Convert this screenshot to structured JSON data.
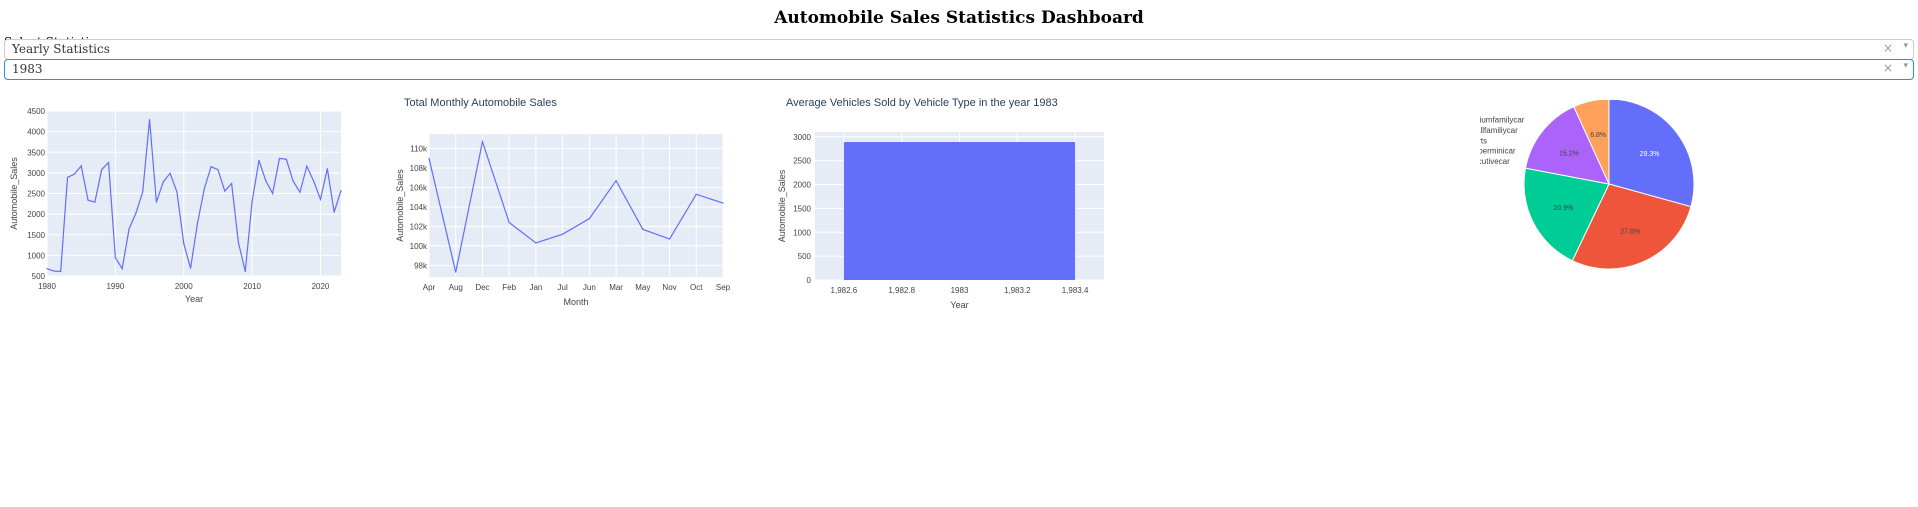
{
  "page": {
    "title": "Automobile Sales Statistics Dashboard"
  },
  "controls": {
    "select_label": "Select Statistics:",
    "statistics": {
      "value": "Yearly Statistics",
      "clear_glyph": "×",
      "arrow_glyph": "▾"
    },
    "year": {
      "value": "1983",
      "clear_glyph": "×",
      "arrow_glyph": "▾"
    }
  },
  "colors": {
    "line": "#636efa",
    "bar": "#636efa",
    "plot_bg": "#e5ecf6",
    "grid": "#ffffff",
    "axis_text": "#444444",
    "title_text": "#2a3f5f",
    "pie": [
      "#636efa",
      "#ef553b",
      "#00cc96",
      "#ab63fa",
      "#ffa15a"
    ]
  },
  "chart_data": [
    {
      "type": "line",
      "title": "",
      "xlabel": "Year",
      "ylabel": "Automobile_Sales",
      "xlim": [
        1980,
        2023
      ],
      "ylim": [
        500,
        4500
      ],
      "xticks": [
        "1980",
        "1990",
        "2000",
        "2010",
        "2020"
      ],
      "yticks": [
        "500",
        "1000",
        "1500",
        "2000",
        "2500",
        "3000",
        "3500",
        "4000",
        "4500"
      ],
      "x": [
        1980,
        1981,
        1982,
        1983,
        1984,
        1985,
        1986,
        1987,
        1988,
        1989,
        1990,
        1991,
        1992,
        1993,
        1994,
        1995,
        1996,
        1997,
        1998,
        1999,
        2000,
        2001,
        2002,
        2003,
        2004,
        2005,
        2006,
        2007,
        2008,
        2009,
        2010,
        2011,
        2012,
        2013,
        2014,
        2015,
        2016,
        2017,
        2018,
        2019,
        2020,
        2021,
        2022,
        2023
      ],
      "values": [
        680,
        620,
        610,
        2890,
        2970,
        3170,
        2340,
        2290,
        3080,
        3250,
        940,
        680,
        1640,
        2020,
        2540,
        4290,
        2290,
        2780,
        2990,
        2540,
        1290,
        690,
        1770,
        2610,
        3150,
        3080,
        2560,
        2740,
        1310,
        610,
        2310,
        3300,
        2810,
        2500,
        3350,
        3330,
        2800,
        2530,
        3160,
        2800,
        2360,
        3100,
        2050,
        2570
      ]
    },
    {
      "type": "line",
      "title": "Total Monthly Automobile Sales",
      "xlabel": "Month",
      "ylabel": "Automobile_Sales",
      "categories": [
        "Apr",
        "Aug",
        "Dec",
        "Feb",
        "Jan",
        "Jul",
        "Jun",
        "Mar",
        "May",
        "Nov",
        "Oct",
        "Sep"
      ],
      "values": [
        109000,
        97300,
        110700,
        102400,
        100300,
        101200,
        102800,
        106700,
        101700,
        100700,
        105300,
        104400
      ],
      "ylim": [
        96800,
        111500
      ],
      "yticks": [
        "98k",
        "100k",
        "102k",
        "104k",
        "106k",
        "108k",
        "110k"
      ]
    },
    {
      "type": "bar",
      "title": "Average Vehicles Sold by Vehicle Type in the year 1983",
      "xlabel": "Year",
      "ylabel": "Automobile_Sales",
      "categories": [
        "1983"
      ],
      "values": [
        2890
      ],
      "xlim": [
        1982.5,
        1983.5
      ],
      "ylim": [
        0,
        3100
      ],
      "xticks": [
        "1,982.6",
        "1,982.8",
        "1983",
        "1,983.2",
        "1,983.4"
      ],
      "yticks": [
        "0",
        "500",
        "1000",
        "1500",
        "2000",
        "2500",
        "3000"
      ]
    },
    {
      "type": "pie",
      "title": "",
      "labels": [
        "Mediumfamilycar",
        "Smallfamiliycar",
        "Sports",
        "Supperminicar",
        "Executivecar"
      ],
      "values": [
        29.3,
        27.8,
        20.9,
        15.2,
        6.8
      ],
      "slice_labels": [
        "29.3%",
        "27.8%",
        "20.9%",
        "15.2%",
        "6.8%"
      ],
      "legend": "right"
    }
  ]
}
